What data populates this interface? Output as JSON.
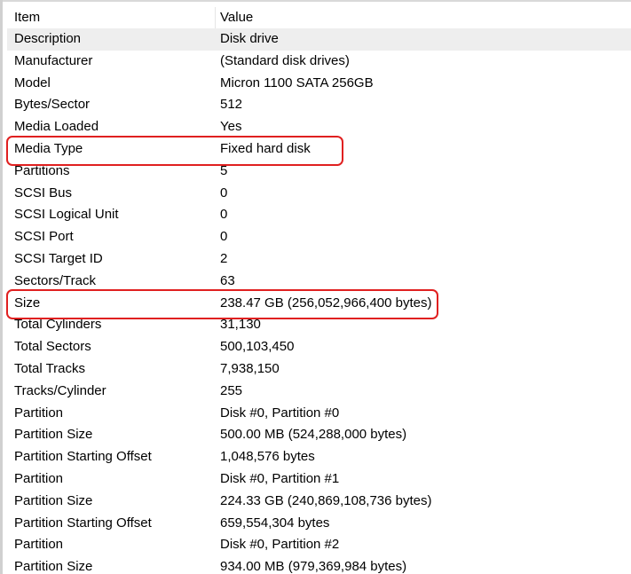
{
  "columns": {
    "item": "Item",
    "value": "Value"
  },
  "rows": [
    {
      "item": "Description",
      "value": "Disk drive"
    },
    {
      "item": "Manufacturer",
      "value": "(Standard disk drives)"
    },
    {
      "item": "Model",
      "value": "Micron 1100 SATA 256GB"
    },
    {
      "item": "Bytes/Sector",
      "value": "512"
    },
    {
      "item": "Media Loaded",
      "value": "Yes"
    },
    {
      "item": "Media Type",
      "value": "Fixed hard disk"
    },
    {
      "item": "Partitions",
      "value": "5"
    },
    {
      "item": "SCSI Bus",
      "value": "0"
    },
    {
      "item": "SCSI Logical Unit",
      "value": "0"
    },
    {
      "item": "SCSI Port",
      "value": "0"
    },
    {
      "item": "SCSI Target ID",
      "value": "2"
    },
    {
      "item": "Sectors/Track",
      "value": "63"
    },
    {
      "item": "Size",
      "value": "238.47 GB (256,052,966,400 bytes)"
    },
    {
      "item": "Total Cylinders",
      "value": "31,130"
    },
    {
      "item": "Total Sectors",
      "value": "500,103,450"
    },
    {
      "item": "Total Tracks",
      "value": "7,938,150"
    },
    {
      "item": "Tracks/Cylinder",
      "value": "255"
    },
    {
      "item": "Partition",
      "value": "Disk #0, Partition #0"
    },
    {
      "item": "Partition Size",
      "value": "500.00 MB (524,288,000 bytes)"
    },
    {
      "item": "Partition Starting Offset",
      "value": "1,048,576 bytes"
    },
    {
      "item": "Partition",
      "value": "Disk #0, Partition #1"
    },
    {
      "item": "Partition Size",
      "value": "224.33 GB (240,869,108,736 bytes)"
    },
    {
      "item": "Partition Starting Offset",
      "value": "659,554,304 bytes"
    },
    {
      "item": "Partition",
      "value": "Disk #0, Partition #2"
    },
    {
      "item": "Partition Size",
      "value": "934.00 MB (979,369,984 bytes)"
    }
  ],
  "selected_row": "Description",
  "highlighted_rows": [
    "Media Type",
    "Size"
  ],
  "colors": {
    "highlight": "#e02020",
    "selected_row": "#eeeeee"
  }
}
